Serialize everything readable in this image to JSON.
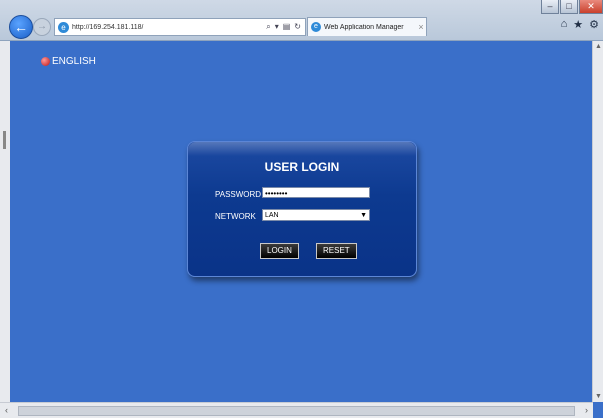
{
  "browser": {
    "address_url": "http://169.254.181.118/",
    "tab_title": "Web Application Manager",
    "titlebar_buttons": [
      "–",
      "□",
      "✕"
    ],
    "tab_close": "×",
    "addr_tools": [
      "⌕",
      "▾",
      "▤",
      "↻"
    ],
    "right_icons": [
      "⌂",
      "★",
      "⚙"
    ]
  },
  "page": {
    "language": "ENGLISH",
    "login": {
      "title": "USER LOGIN",
      "password_label": "PASSWORD",
      "password_value": "••••••••",
      "network_label": "NETWORK",
      "network_value": "LAN",
      "login_button": "LOGIN",
      "reset_button": "RESET"
    }
  },
  "colors": {
    "page_background": "#3a6fc9",
    "login_panel": "#0d3a90"
  }
}
